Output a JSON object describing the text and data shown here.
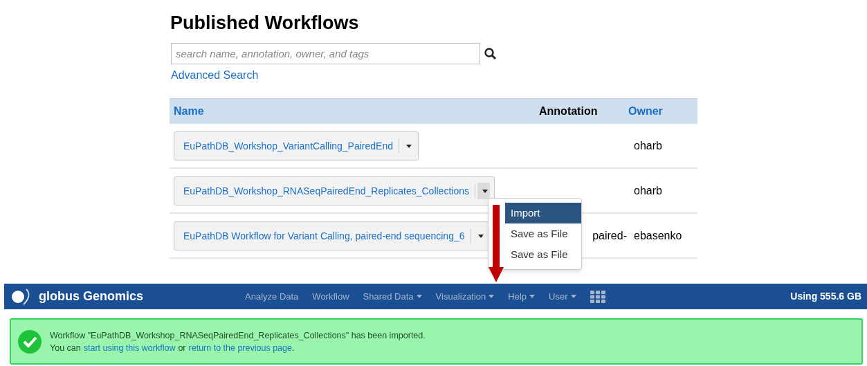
{
  "page": {
    "title": "Published Workflows"
  },
  "search": {
    "placeholder": "search name, annotation, owner, and tags",
    "advanced_link": "Advanced Search"
  },
  "table": {
    "columns": [
      {
        "label": "Name",
        "sortable": true
      },
      {
        "label": "Annotation",
        "sortable": false
      },
      {
        "label": "Owner",
        "sortable": true
      }
    ],
    "rows": [
      {
        "name": "EuPathDB_Workshop_VariantCalling_PairedEnd",
        "annotation": "",
        "owner": "oharb",
        "menu_open": false
      },
      {
        "name": "EuPathDB_Workshop_RNASeqPairedEnd_Replicates_Collections",
        "annotation": "",
        "owner": "oharb",
        "menu_open": true
      },
      {
        "name": "EuPathDB Workflow for Variant Calling, paired-end sequencing_6",
        "annotation": "paired-",
        "owner": "ebasenko",
        "menu_open": false
      }
    ]
  },
  "menu": {
    "items": [
      {
        "label": "Import",
        "selected": true
      },
      {
        "label": "Save as File",
        "selected": false
      },
      {
        "label": "Save as File",
        "selected": false
      }
    ]
  },
  "navbar": {
    "brand": "globus Genomics",
    "items": [
      {
        "label": "Analyze Data",
        "dropdown": false
      },
      {
        "label": "Workflow",
        "dropdown": false
      },
      {
        "label": "Shared Data",
        "dropdown": true
      },
      {
        "label": "Visualization",
        "dropdown": true
      },
      {
        "label": "Help",
        "dropdown": true
      },
      {
        "label": "User",
        "dropdown": true
      }
    ],
    "usage": "Using 555.6 GB"
  },
  "alert": {
    "message": "Workflow \"EuPathDB_Workshop_RNASeqPairedEnd_Replicates_Collections\" has been imported.",
    "line2_prefix": "You can",
    "link1": "start using this workflow",
    "middle": "or",
    "link2": "return to the previous page",
    "suffix": "."
  }
}
